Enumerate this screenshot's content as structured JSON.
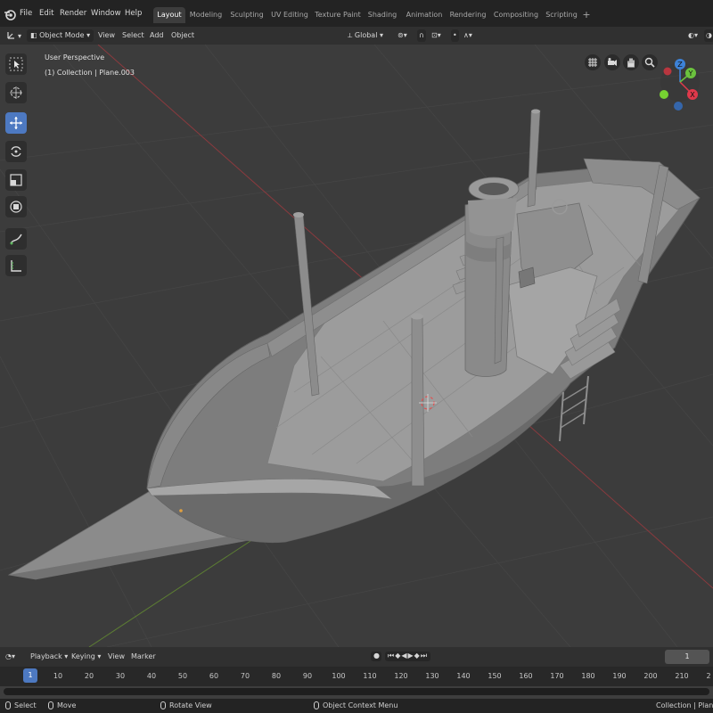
{
  "menu": [
    "File",
    "Edit",
    "Render",
    "Window",
    "Help"
  ],
  "workspaces": [
    "Layout",
    "Modeling",
    "Sculpting",
    "UV Editing",
    "Texture Paint",
    "Shading",
    "Animation",
    "Rendering",
    "Compositing",
    "Scripting"
  ],
  "active_workspace": "Layout",
  "add_workspace": "+",
  "header": {
    "mode": "Object Mode",
    "view": "View",
    "select": "Select",
    "add": "Add",
    "object": "Object",
    "orientation": "Global"
  },
  "viewport": {
    "perspective": "User Perspective",
    "collection": "(1) Collection | Plane.003"
  },
  "gizmo": {
    "z": "Z",
    "y": "Y",
    "x": "X"
  },
  "timeline": {
    "playback": "Playback",
    "keying": "Keying",
    "view": "View",
    "marker": "Marker",
    "current_frame": "1",
    "ticks": [
      "1",
      "10",
      "20",
      "30",
      "40",
      "50",
      "60",
      "70",
      "80",
      "90",
      "100",
      "110",
      "120",
      "130",
      "140",
      "150",
      "160",
      "170",
      "180",
      "190",
      "200",
      "210",
      "2"
    ]
  },
  "status": {
    "select": "Select",
    "move": "Move",
    "rotate": "Rotate View",
    "context": "Object Context Menu",
    "right": "Collection | Plane"
  },
  "colors": {
    "accent": "#4d79c1",
    "gizmo_x": "#e0394b",
    "gizmo_y": "#6bc23e",
    "gizmo_z": "#3d82d8"
  }
}
